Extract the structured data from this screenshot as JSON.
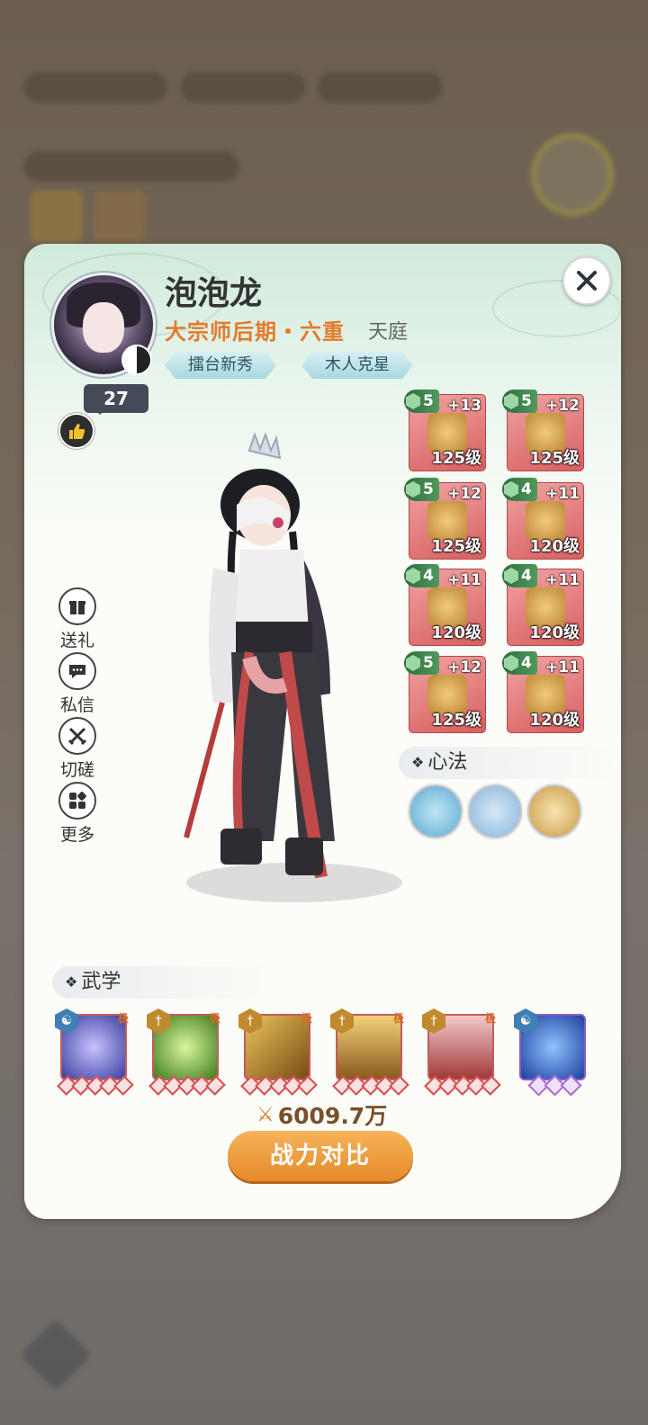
{
  "profile": {
    "name": "泡泡龙",
    "rank": "大宗师后期・六重",
    "realm": "天庭",
    "titles": [
      "擂台新秀",
      "木人克星"
    ],
    "likes": "27"
  },
  "side_actions": [
    {
      "label": "送礼",
      "icon": "gift-icon"
    },
    {
      "label": "私信",
      "icon": "message-icon"
    },
    {
      "label": "切磋",
      "icon": "crossed-swords-icon"
    },
    {
      "label": "更多",
      "icon": "more-grid-icon"
    }
  ],
  "equipment": [
    {
      "slot": "sword",
      "tier": "5",
      "enhance": "+13",
      "level": "125级"
    },
    {
      "slot": "helmet",
      "tier": "5",
      "enhance": "+12",
      "level": "125级"
    },
    {
      "slot": "armor",
      "tier": "5",
      "enhance": "+12",
      "level": "125级"
    },
    {
      "slot": "pants",
      "tier": "4",
      "enhance": "+11",
      "level": "120级"
    },
    {
      "slot": "boots-left",
      "tier": "4",
      "enhance": "+11",
      "level": "120级"
    },
    {
      "slot": "boots-right",
      "tier": "4",
      "enhance": "+11",
      "level": "120级"
    },
    {
      "slot": "ring",
      "tier": "5",
      "enhance": "+12",
      "level": "125级"
    },
    {
      "slot": "charm",
      "tier": "4",
      "enhance": "+11",
      "level": "120级"
    }
  ],
  "sections": {
    "xinfa": "心法",
    "wuxue": "武学"
  },
  "xinfa_icons": [
    "kick-pose-icon",
    "meditation-icon",
    "golden-warrior-icon"
  ],
  "skills": [
    {
      "icon": "blue-orb-skill-icon",
      "badge": "blue",
      "pips": 5,
      "pip_color": "red",
      "tag": "极"
    },
    {
      "icon": "green-slash-skill-icon",
      "badge": "gold",
      "pips": 5,
      "pip_color": "red",
      "tag": "极"
    },
    {
      "icon": "golden-swords-skill-icon",
      "badge": "gold",
      "pips": 5,
      "pip_color": "red",
      "tag": "极"
    },
    {
      "icon": "sword-rain-skill-icon",
      "badge": "gold",
      "pips": 5,
      "pip_color": "red",
      "tag": "极"
    },
    {
      "icon": "red-blades-skill-icon",
      "badge": "gold",
      "pips": 5,
      "pip_color": "red",
      "tag": "极"
    },
    {
      "icon": "crystal-cubes-skill-icon",
      "badge": "blue",
      "pips": 3,
      "pip_color": "purple",
      "tag": ""
    }
  ],
  "combat_power": "6009.7万",
  "compare_button": "战力对比",
  "colors": {
    "accent_orange": "#e27c2c",
    "equip_red": "#d86060",
    "tier_green": "#2f6b3e",
    "button_orange": "#e58a2a"
  }
}
